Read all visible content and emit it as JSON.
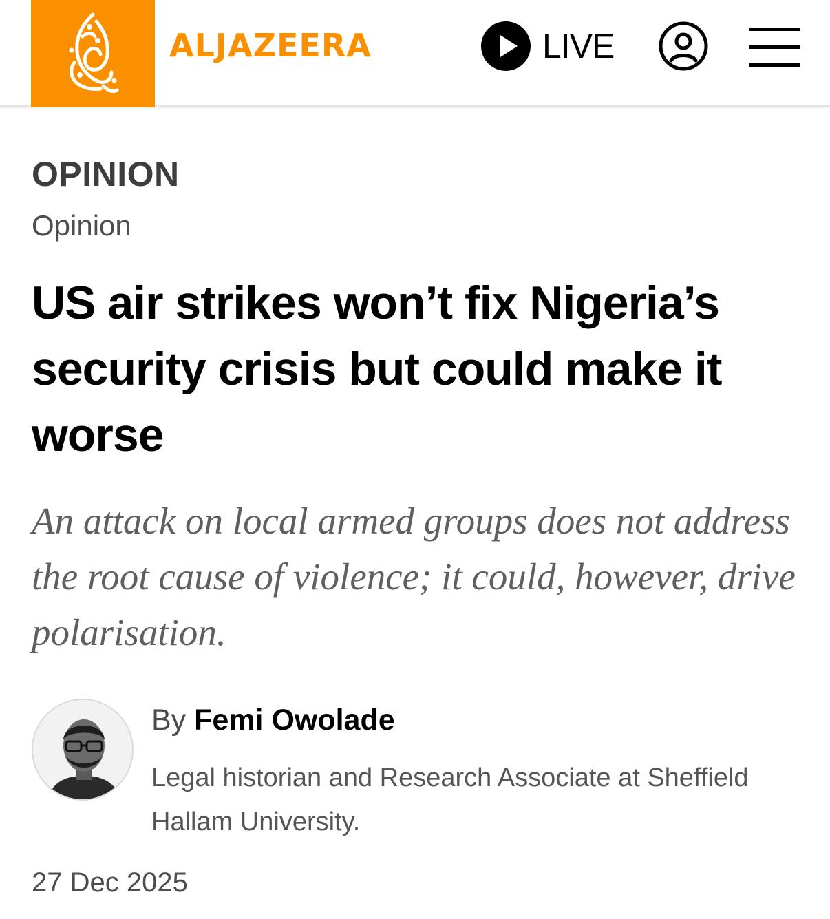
{
  "header": {
    "brand": "ALJAZEERA",
    "live_label": "LIVE",
    "brand_color": "#fa9000",
    "logo_icon": "al-jazeera-calligraphy-logo",
    "live_icon": "play-circle-icon",
    "account_icon": "user-account-icon",
    "menu_icon": "hamburger-menu-icon"
  },
  "article": {
    "kicker": "OPINION",
    "category": "Opinion",
    "headline": "US air strikes won’t fix Nigeria’s security crisis but could make it worse",
    "standfirst": "An attack on local armed groups does not address the root cause of violence; it could, however, drive polarisation.",
    "byline_prefix": "By",
    "author_name": "Femi Owolade",
    "author_bio": "Legal historian and Research Associate at Sheffield Hallam University.",
    "date": "27 Dec 2025"
  }
}
